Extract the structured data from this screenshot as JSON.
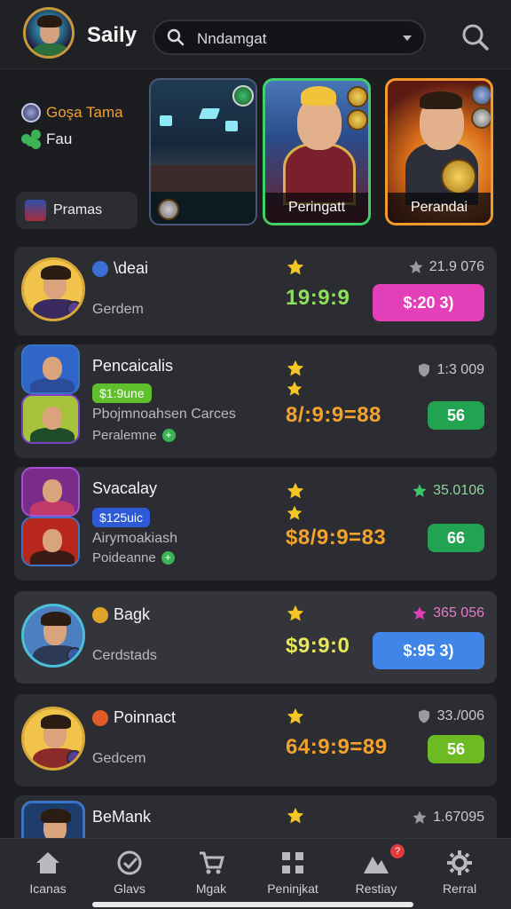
{
  "header": {
    "app_title": "Saily",
    "search_value": "Nndamgat",
    "icons": [
      "search-icon",
      "chevron-down-icon",
      "search-icon"
    ]
  },
  "featured": {
    "left_rows": [
      {
        "label": "Goşa Tama",
        "icon": "coin-icon",
        "color": "#f2a036"
      },
      {
        "label": "Fau",
        "icon": "clover-icon",
        "color": "#3db357"
      }
    ],
    "pramas_label": "Pramas",
    "cards": [
      {
        "caption": ""
      },
      {
        "caption": "Peringatt"
      },
      {
        "caption": "Perandai"
      }
    ]
  },
  "list": [
    {
      "name": "\\deai",
      "sub": "Gerdem",
      "time": "19:9:9",
      "stat": "21.9 076",
      "button": "$:20 3)",
      "button_color": "#e23fb9"
    },
    {
      "name": "Pencaicalis",
      "tag": "$1:9une",
      "sub": "Pbojmnoahsen Carces",
      "sub2": "Peralemne",
      "time": "8/:9:9=88",
      "stat": "1:3 009",
      "button": "56",
      "button_color": "#22a352"
    },
    {
      "name": "Svacalay",
      "tag": "$125uic",
      "sub": "Airymoakiash",
      "sub2": "Poideanne",
      "time": "$8/9:9=83",
      "stat": "35.0106",
      "button": "66",
      "button_color": "#22a352"
    },
    {
      "name": "Bagk",
      "sub": "Cerdstads",
      "time": "$9:9:0",
      "stat": "365 056",
      "button": "$:95 3)",
      "button_color": "#3f86e8"
    },
    {
      "name": "Poinnact",
      "sub": "Gedcem",
      "time": "64:9:9=89",
      "stat": "33./006",
      "button": "56",
      "button_color": "#6dbb22"
    },
    {
      "name": "BeMank",
      "stat": "1.67095"
    }
  ],
  "nav": [
    {
      "label": "Icanas",
      "icon": "home-icon"
    },
    {
      "label": "Glavs",
      "icon": "check-badge-icon"
    },
    {
      "label": "Mgak",
      "icon": "cart-icon"
    },
    {
      "label": "Peninjkat",
      "icon": "grid-icon"
    },
    {
      "label": "Restiay",
      "icon": "mountain-icon",
      "badge": "?"
    },
    {
      "label": "Rerral",
      "icon": "gear-icon"
    }
  ]
}
